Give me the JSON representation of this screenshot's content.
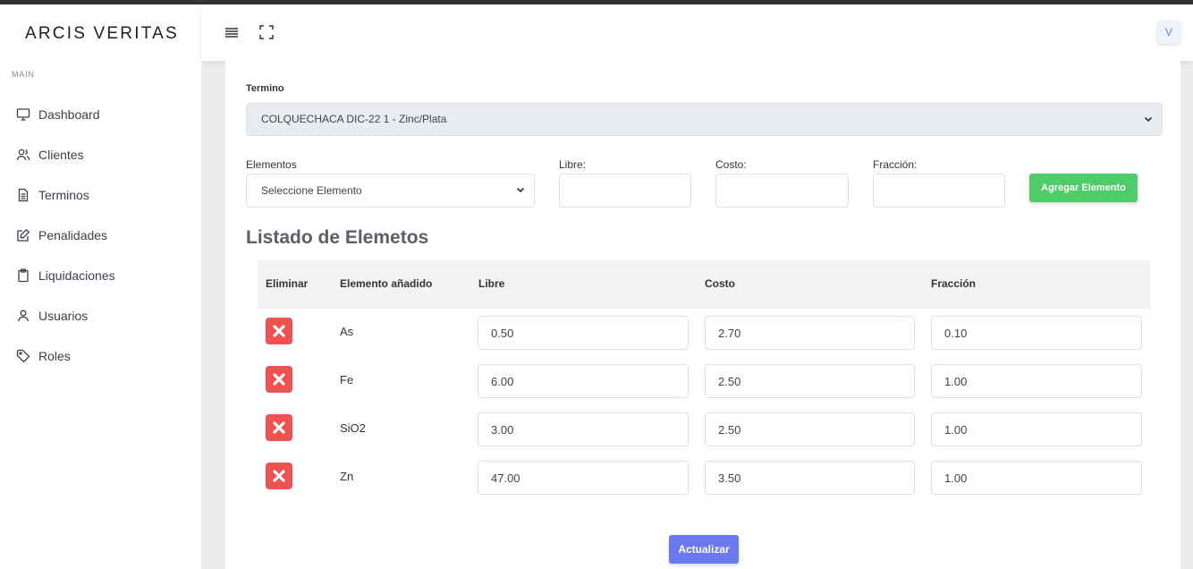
{
  "app": {
    "brand": "ARCIS VERITAS",
    "section_label": "MAIN",
    "avatar_initial": "V"
  },
  "sidebar": {
    "items": [
      {
        "label": "Dashboard",
        "icon": "monitor-icon"
      },
      {
        "label": "Clientes",
        "icon": "users-icon"
      },
      {
        "label": "Terminos",
        "icon": "document-icon"
      },
      {
        "label": "Penalidades",
        "icon": "edit-icon"
      },
      {
        "label": "Liquidaciones",
        "icon": "clipboard-icon"
      },
      {
        "label": "Usuarios",
        "icon": "user-icon"
      },
      {
        "label": "Roles",
        "icon": "tag-icon"
      }
    ]
  },
  "form": {
    "termino_label": "Termino",
    "termino_value": "COLQUECHACA DIC-22 1 - Zinc/Plata",
    "elementos_label": "Elementos",
    "elementos_value": "Seleccione Elemento",
    "libre_label": "Libre:",
    "costo_label": "Costo:",
    "fraccion_label": "Fracción:",
    "libre_value": "",
    "costo_value": "",
    "fraccion_value": "",
    "add_button": "Agregar Elemento"
  },
  "list": {
    "title": "Listado de Elemetos",
    "columns": [
      "Eliminar",
      "Elemento añadido",
      "Libre",
      "Costo",
      "Fracción"
    ],
    "rows": [
      {
        "element": "As",
        "libre": "0.50",
        "costo": "2.70",
        "fraccion": "0.10"
      },
      {
        "element": "Fe",
        "libre": "6.00",
        "costo": "2.50",
        "fraccion": "1.00"
      },
      {
        "element": "SiO2",
        "libre": "3.00",
        "costo": "2.50",
        "fraccion": "1.00"
      },
      {
        "element": "Zn",
        "libre": "47.00",
        "costo": "3.50",
        "fraccion": "1.00"
      }
    ],
    "update_button": "Actualizar"
  },
  "colors": {
    "green": "#4fcc6a",
    "blue": "#6c78ee",
    "red": "#f0524f"
  }
}
